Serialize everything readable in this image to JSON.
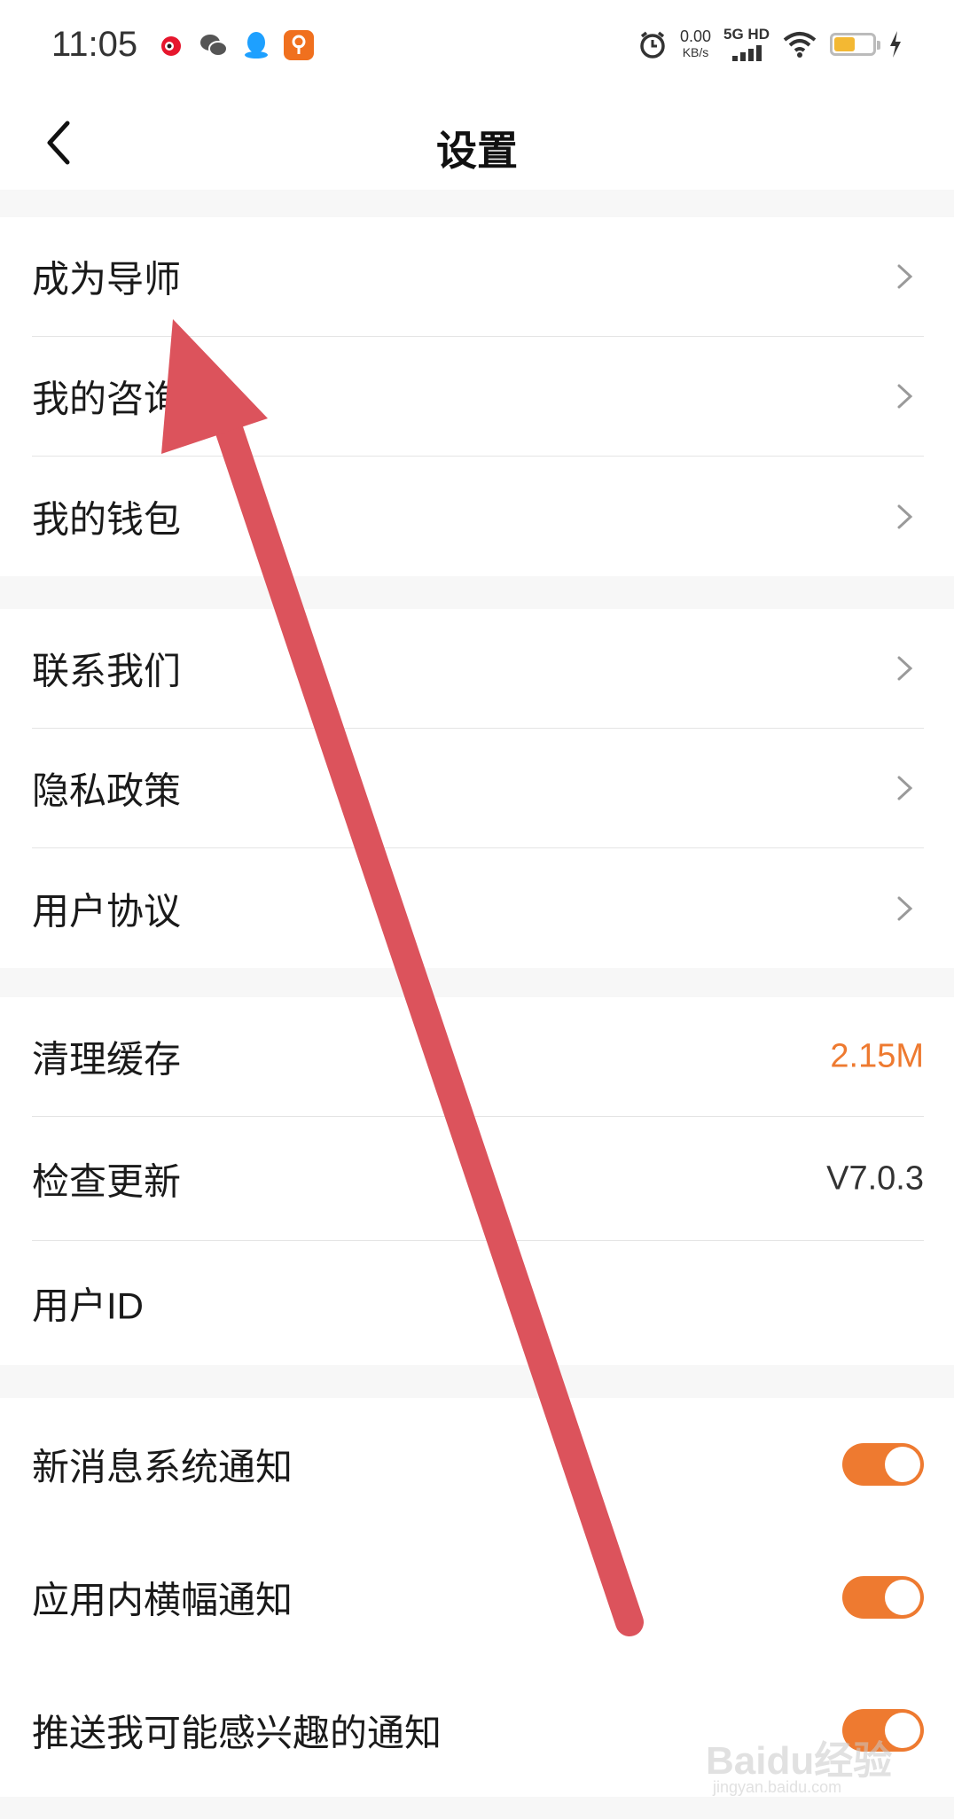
{
  "status_bar": {
    "time": "11:05",
    "net_speed_value": "0.00",
    "net_speed_unit": "KB/s",
    "signal_label": "5G HD",
    "notification_icons": [
      "weibo-icon",
      "wechat-icon",
      "qq-icon",
      "app-icon"
    ],
    "battery_level": 0.55
  },
  "nav": {
    "title": "设置"
  },
  "groups": [
    {
      "items": [
        {
          "label": "成为导师",
          "type": "link"
        },
        {
          "label": "我的咨询",
          "type": "link"
        },
        {
          "label": "我的钱包",
          "type": "link"
        }
      ]
    },
    {
      "items": [
        {
          "label": "联系我们",
          "type": "link"
        },
        {
          "label": "隐私政策",
          "type": "link"
        },
        {
          "label": "用户协议",
          "type": "link"
        }
      ]
    },
    {
      "items": [
        {
          "label": "清理缓存",
          "type": "value",
          "value": "2.15M"
        },
        {
          "label": "检查更新",
          "type": "value",
          "value": "V7.0.3"
        },
        {
          "label": "用户ID",
          "type": "value",
          "value": ""
        }
      ]
    },
    {
      "items": [
        {
          "label": "新消息系统通知",
          "type": "toggle",
          "on": true
        },
        {
          "label": "应用内横幅通知",
          "type": "toggle",
          "on": true
        },
        {
          "label": "推送我可能感兴趣的通知",
          "type": "toggle",
          "on": true
        }
      ]
    }
  ],
  "colors": {
    "accent": "#ee7a30",
    "arrow": "#dc535c",
    "value_text": "#333333"
  },
  "watermark": {
    "text": "Baidu经验",
    "sub": "jingyan.baidu.com"
  }
}
